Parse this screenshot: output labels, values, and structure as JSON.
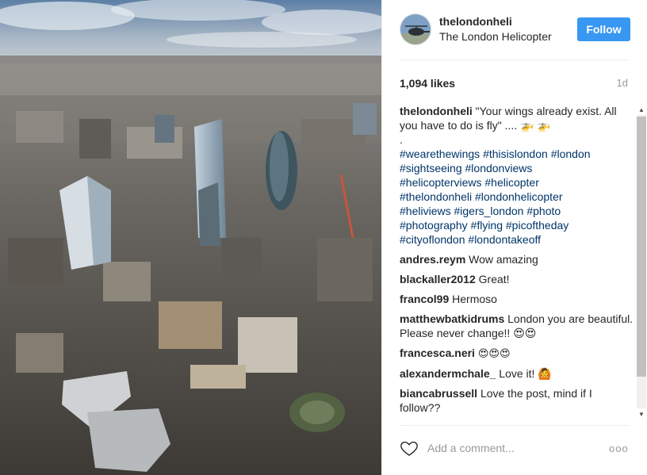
{
  "post": {
    "image_alt": "Aerial view of the City of London skyline",
    "username": "thelondonheli",
    "full_name": "The London Helicopter",
    "follow_label": "Follow",
    "likes": "1,094 likes",
    "time": "1d"
  },
  "caption": {
    "author": "thelondonheli",
    "text": "\"Your wings already exist. All you have to do is fly\" .... 🚁 🚁",
    "dot": ".",
    "hashtags": [
      "#wearethewings",
      "#thisislondon",
      "#london",
      "#sightseeing",
      "#londonviews",
      "#helicopterviews",
      "#helicopter",
      "#thelondonheli",
      "#londonhelicopter",
      "#heliviews",
      "#igers_london",
      "#photo",
      "#photography",
      "#flying",
      "#picoftheday",
      "#cityoflondon",
      "#londontakeoff"
    ]
  },
  "comments": [
    {
      "author": "andres.reym",
      "text": "Wow amazing"
    },
    {
      "author": "blackaller2012",
      "text": "Great!"
    },
    {
      "author": "francol99",
      "text": "Hermoso"
    },
    {
      "author": "matthewbatkidrums",
      "text": "London you are beautiful. Please never change!! 😍😍"
    },
    {
      "author": "francesca.neri",
      "text": "😍😍😍"
    },
    {
      "author": "alexandermchale_",
      "text": "Love it! 🙆"
    },
    {
      "author": "biancabrussell",
      "text": "Love the post, mind if I follow??"
    }
  ],
  "footer": {
    "comment_placeholder": "Add a comment...",
    "more_label": "ooo"
  },
  "scrollbar": {
    "up_arrow": "▲",
    "down_arrow": "▼"
  },
  "colors": {
    "follow_button": "#3897f0",
    "hashtag": "#003569",
    "muted": "#999999"
  },
  "icons": {
    "heart": "heart-outline-icon",
    "more": "more-options-icon"
  }
}
